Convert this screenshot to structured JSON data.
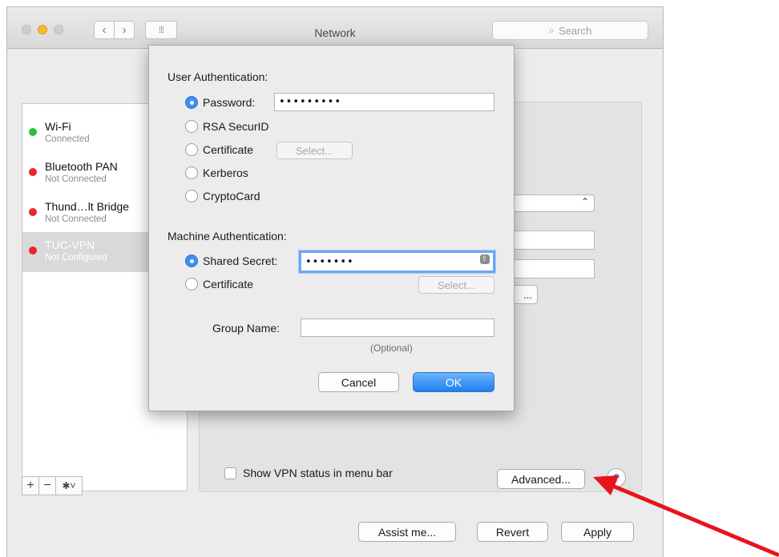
{
  "window": {
    "title": "Network",
    "search_placeholder": "Search",
    "nav_back": "‹",
    "nav_forward": "›",
    "nav_grid": "⁞⁞⁞"
  },
  "services": [
    {
      "name": "Wi-Fi",
      "status": "Connected",
      "status_color": "#2fbf3a",
      "selected": false
    },
    {
      "name": "Bluetooth PAN",
      "status": "Not Connected",
      "status_color": "#e8242c",
      "selected": false
    },
    {
      "name": "Thund…lt Bridge",
      "status": "Not Connected",
      "status_color": "#e8242c",
      "selected": false
    },
    {
      "name": "TUC-VPN",
      "status": "Not Configured",
      "status_color": "#e8242c",
      "selected": true
    }
  ],
  "sidebar_tools": {
    "add": "+",
    "remove": "−",
    "gear": "✱˅"
  },
  "panel": {
    "show_vpn_status_label": "Show VPN status in menu bar",
    "advanced_label": "Advanced...",
    "help_label": "?",
    "partial_button_label": "..."
  },
  "footer": {
    "assist_label": "Assist me...",
    "revert_label": "Revert",
    "apply_label": "Apply"
  },
  "sheet": {
    "user_auth_label": "User Authentication:",
    "user_auth_options": [
      {
        "label": "Password:",
        "selected": true
      },
      {
        "label": "RSA SecurID",
        "selected": false
      },
      {
        "label": "Certificate",
        "selected": false
      },
      {
        "label": "Kerberos",
        "selected": false
      },
      {
        "label": "CryptoCard",
        "selected": false
      }
    ],
    "password_value": "•••••••••",
    "user_cert_select_label": "Select...",
    "machine_auth_label": "Machine Authentication:",
    "machine_auth_options": [
      {
        "label": "Shared Secret:",
        "selected": true
      },
      {
        "label": "Certificate",
        "selected": false
      }
    ],
    "shared_secret_value": "•••••••",
    "machine_cert_select_label": "Select...",
    "group_name_label": "Group Name:",
    "group_name_value": "",
    "optional_label": "(Optional)",
    "cancel_label": "Cancel",
    "ok_label": "OK"
  },
  "accent_color": "#2f80f0",
  "annotation_arrow_color": "#e8141c"
}
